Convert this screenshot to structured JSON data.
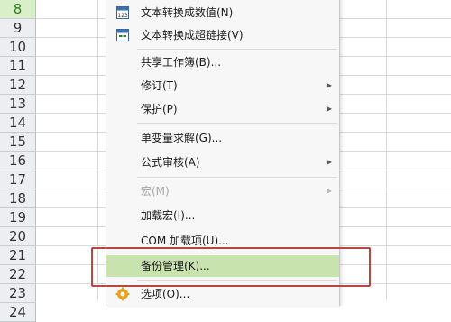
{
  "rows": [
    "8",
    "9",
    "10",
    "11",
    "12",
    "13",
    "14",
    "15",
    "16",
    "17",
    "18",
    "19",
    "20",
    "21",
    "22",
    "23",
    "24"
  ],
  "menu": {
    "items": [
      {
        "label": "文本转换成数值(N)",
        "icon": "convert-number-icon",
        "state": "normal"
      },
      {
        "label": "文本转换成超链接(V)",
        "icon": "convert-hyperlink-icon",
        "state": "normal"
      },
      {
        "label": "共享工作簿(B)...",
        "state": "normal"
      },
      {
        "label": "修订(T)",
        "state": "normal",
        "submenu": true
      },
      {
        "label": "保护(P)",
        "state": "normal",
        "submenu": true
      },
      {
        "label": "单变量求解(G)...",
        "state": "normal"
      },
      {
        "label": "公式审核(A)",
        "state": "normal",
        "submenu": true
      },
      {
        "label": "宏(M)",
        "state": "disabled",
        "submenu": true
      },
      {
        "label": "加载宏(I)...",
        "state": "normal"
      },
      {
        "label": "COM 加载项(U)...",
        "state": "normal"
      },
      {
        "label": "备份管理(K)...",
        "state": "highlighted"
      },
      {
        "label": "选项(O)...",
        "icon": "gear-icon",
        "state": "normal"
      }
    ]
  },
  "colors": {
    "highlight": "#c8e3ae",
    "callout_border": "#b7473f",
    "active_row_header": "#d9efc9"
  }
}
